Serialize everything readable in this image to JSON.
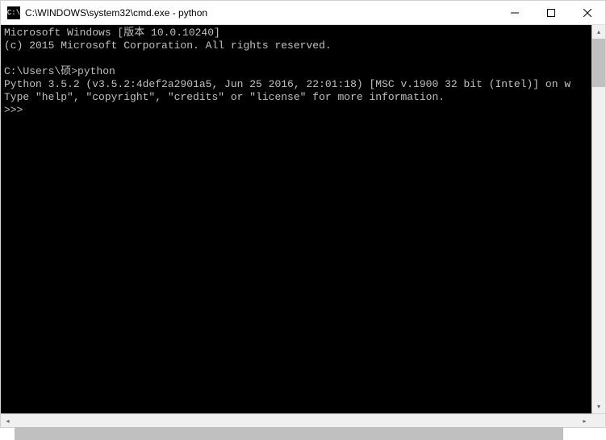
{
  "titlebar": {
    "icon_text": "C:\\",
    "title": "C:\\WINDOWS\\system32\\cmd.exe - python"
  },
  "terminal": {
    "lines": [
      "Microsoft Windows [版本 10.0.10240]",
      "(c) 2015 Microsoft Corporation. All rights reserved.",
      "",
      "C:\\Users\\硕>python",
      "Python 3.5.2 (v3.5.2:4def2a2901a5, Jun 25 2016, 22:01:18) [MSC v.1900 32 bit (Intel)] on w",
      "Type \"help\", \"copyright\", \"credits\" or \"license\" for more information.",
      ">>>"
    ]
  }
}
